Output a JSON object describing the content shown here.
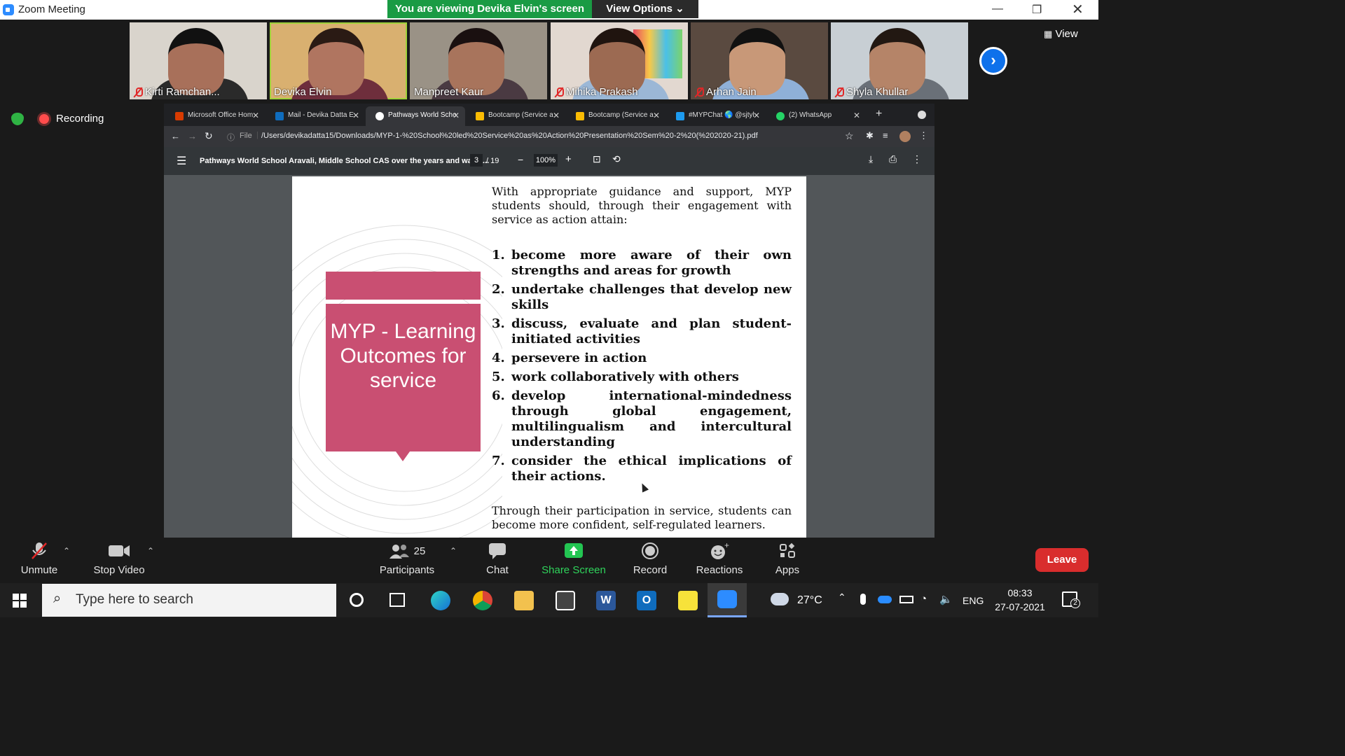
{
  "window": {
    "title": "Zoom Meeting"
  },
  "banner": {
    "viewing": "You are viewing Devika Elvin's screen",
    "view_options": "View Options ⌄"
  },
  "participants_strip": {
    "tiles": [
      {
        "name": "Kirti Ramchan...",
        "muted": true
      },
      {
        "name": "Devika Elvin",
        "muted": false
      },
      {
        "name": "Manpreet Kaur",
        "muted": false
      },
      {
        "name": "Mihika Prakash",
        "muted": true
      },
      {
        "name": "Arhan Jain",
        "muted": true
      },
      {
        "name": "Shyla Khullar",
        "muted": true
      }
    ],
    "view_label": "View"
  },
  "status": {
    "recording": "Recording"
  },
  "browser": {
    "tabs": [
      {
        "label": "Microsoft Office Hom",
        "color": "#d83b01"
      },
      {
        "label": "Mail - Devika Datta E",
        "color": "#0f6cbd"
      },
      {
        "label": "Pathways World Scho",
        "color": "#ffffff"
      },
      {
        "label": "Bootcamp (Service a",
        "color": "#fbbc04"
      },
      {
        "label": "Bootcamp (Service a",
        "color": "#fbbc04"
      },
      {
        "label": "#MYPChat 🌎 @sjtyl",
        "color": "#1d9bf0"
      },
      {
        "label": "(2) WhatsApp",
        "color": "#25d366"
      }
    ],
    "address_prefix": "File",
    "address": "/Users/devikadatta15/Downloads/MYP-1-%20School%20led%20Service%20as%20Action%20Presentation%20Sem%20-2%20(%202020-21).pdf"
  },
  "pdf": {
    "title": "Pathways World School Aravali, Middle School CAS over the years and way a...",
    "page_current": "3",
    "page_total": "/ 19",
    "zoom": "100%"
  },
  "slide": {
    "box_title": "MYP - Learning Outcomes for service",
    "intro": "With appropriate guidance and support, MYP students should, through their engagement with service as action attain:",
    "outcomes": [
      {
        "num": "1.",
        "text": "become more aware of their own strengths and areas for growth"
      },
      {
        "num": "2.",
        "text": "undertake challenges that develop new skills"
      },
      {
        "num": "3.",
        "text": "discuss, evaluate and plan student-initiated activities"
      },
      {
        "num": "4.",
        "text": "persevere in action"
      },
      {
        "num": "5.",
        "text": "work collaboratively with others"
      },
      {
        "num": "6.",
        "text": "develop international-mindedness through global engagement, multilingualism and intercultural understanding"
      },
      {
        "num": "7.",
        "text": "consider the ethical implications of their actions."
      }
    ],
    "outro": "Through their participation in service, students can become more confident, self-regulated learners."
  },
  "controls": {
    "unmute": "Unmute",
    "stop_video": "Stop Video",
    "participants": "Participants",
    "participants_count": "25",
    "chat": "Chat",
    "share_screen": "Share Screen",
    "record": "Record",
    "reactions": "Reactions",
    "apps": "Apps",
    "leave": "Leave"
  },
  "taskbar": {
    "search_placeholder": "Type here to search",
    "weather": "27°C",
    "language": "ENG",
    "time": "08:33",
    "date": "27-07-2021",
    "notifications": "2"
  }
}
